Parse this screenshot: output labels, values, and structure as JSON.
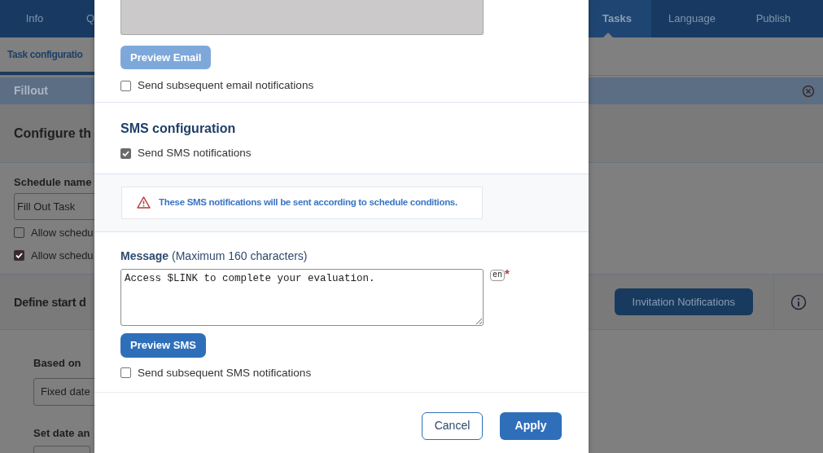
{
  "nav_tabs": [
    {
      "label": "Info",
      "selected": false
    },
    {
      "label": "Q",
      "selected": false
    },
    {
      "label": "Tasks",
      "selected": true
    },
    {
      "label": "Language",
      "selected": false
    },
    {
      "label": "Publish",
      "selected": false
    }
  ],
  "subnav": {
    "label": "Task configuratio"
  },
  "panel": {
    "title": "Fillout"
  },
  "configure_section": {
    "heading": "Configure th",
    "schedule_label": "Schedule name",
    "schedule_value": "Fill Out Task",
    "options": [
      {
        "label": "Allow schedu",
        "checked": false
      },
      {
        "label": "Allow schedu",
        "checked": true
      }
    ]
  },
  "start_section": {
    "heading": "Define start d",
    "button": "Invitation Notifications",
    "based_on_label": "Based on",
    "based_on_value": "Fixed date",
    "set_date_label": "Set date an"
  },
  "dialog": {
    "email": {
      "preview_button": "Preview Email",
      "preview_disabled": true,
      "subsequent": {
        "label": "Send subsequent email notifications",
        "checked": false
      }
    },
    "sms": {
      "heading": "SMS configuration",
      "enable": {
        "label": "Send SMS notifications",
        "checked": true
      },
      "alert": "These SMS notifications will be sent according to schedule conditions.",
      "message_label": "**Message** (Maximum 160 characters)",
      "message_value": "Access $LINK to complete your evaluation.",
      "language": "en",
      "required_mark": "*",
      "preview_button": "Preview SMS",
      "subsequent": {
        "label": "Send subsequent SMS notifications",
        "checked": false
      }
    },
    "buttons": [
      {
        "label": "Cancel",
        "kind": "secondary"
      },
      {
        "label": "Apply",
        "kind": "primary"
      }
    ]
  }
}
